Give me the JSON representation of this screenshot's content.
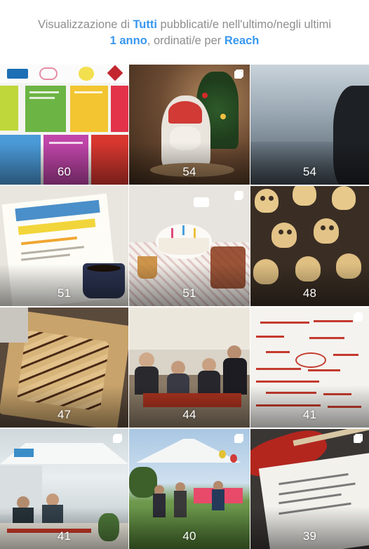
{
  "header": {
    "line1_prefix": "Visualizzazione di ",
    "filter_value": "Tutti",
    "line1_suffix": " pubblicati/e nell'ultimo/negli ultimi",
    "period_value": "1 anno",
    "line2_middle": ", ordinati/e per ",
    "sort_value": "Reach"
  },
  "posts": [
    {
      "count": "60",
      "multi": false
    },
    {
      "count": "54",
      "multi": true
    },
    {
      "count": "54",
      "multi": false
    },
    {
      "count": "51",
      "multi": false
    },
    {
      "count": "51",
      "multi": true
    },
    {
      "count": "48",
      "multi": false
    },
    {
      "count": "47",
      "multi": false
    },
    {
      "count": "44",
      "multi": false
    },
    {
      "count": "41",
      "multi": true
    },
    {
      "count": "41",
      "multi": true
    },
    {
      "count": "40",
      "multi": true
    },
    {
      "count": "39",
      "multi": true
    }
  ],
  "colors": {
    "accent": "#3897f0",
    "muted_text": "#8e8e8e"
  }
}
